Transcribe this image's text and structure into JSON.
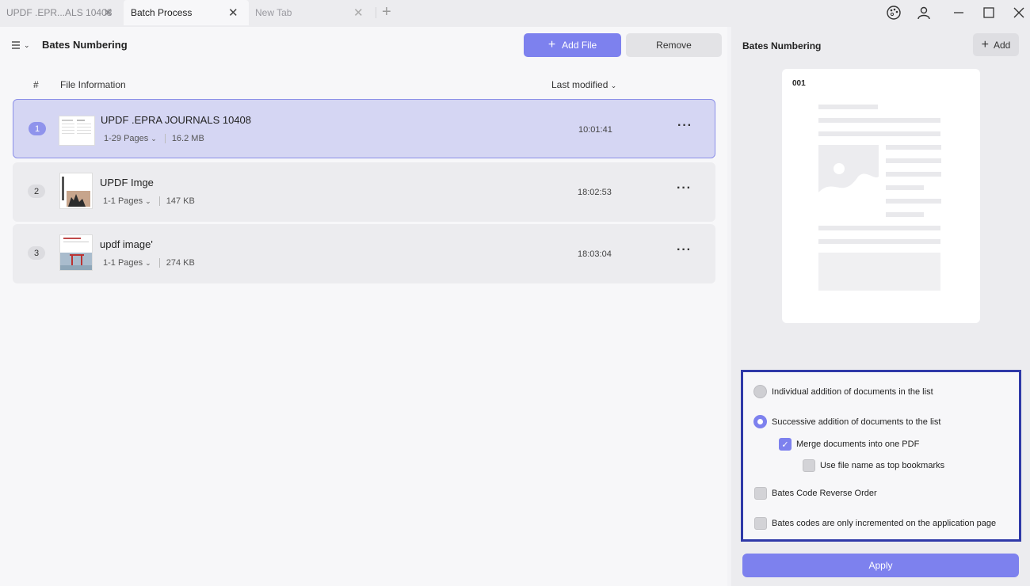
{
  "tabs": [
    {
      "label": "UPDF .EPR...ALS 10408"
    },
    {
      "label": "Batch Process"
    },
    {
      "label": "New Tab"
    }
  ],
  "toolbar": {
    "title": "Bates Numbering",
    "add_file_label": "Add File",
    "remove_label": "Remove"
  },
  "table": {
    "col_index": "#",
    "col_info": "File Information",
    "col_modified": "Last modified"
  },
  "files": [
    {
      "index": "1",
      "name": "UPDF .EPRA JOURNALS 10408",
      "pages": "1-29 Pages",
      "size": "16.2 MB",
      "time": "10:01:41",
      "selected": true
    },
    {
      "index": "2",
      "name": "UPDF Imge",
      "pages": "1-1 Pages",
      "size": "147 KB",
      "time": "18:02:53",
      "selected": false
    },
    {
      "index": "3",
      "name": "updf image'",
      "pages": "1-1 Pages",
      "size": "274 KB",
      "time": "18:03:04",
      "selected": false
    }
  ],
  "right": {
    "title": "Bates Numbering",
    "add_label": "Add",
    "preview_code": "001"
  },
  "options": {
    "individual": "Individual addition of documents in the list",
    "successive": "Successive addition of documents to the list",
    "merge": "Merge documents into one PDF",
    "bookmarks": "Use file name as top bookmarks",
    "reverse": "Bates Code Reverse Order",
    "incremented": "Bates codes are only incremented on the application page"
  },
  "state": {
    "selected_mode": "successive",
    "merge_checked": true,
    "bookmarks_checked": false,
    "reverse_checked": false,
    "incremented_checked": false
  },
  "apply_label": "Apply",
  "colors": {
    "accent": "#7d81ee",
    "highlight_border": "#2f39a8"
  }
}
